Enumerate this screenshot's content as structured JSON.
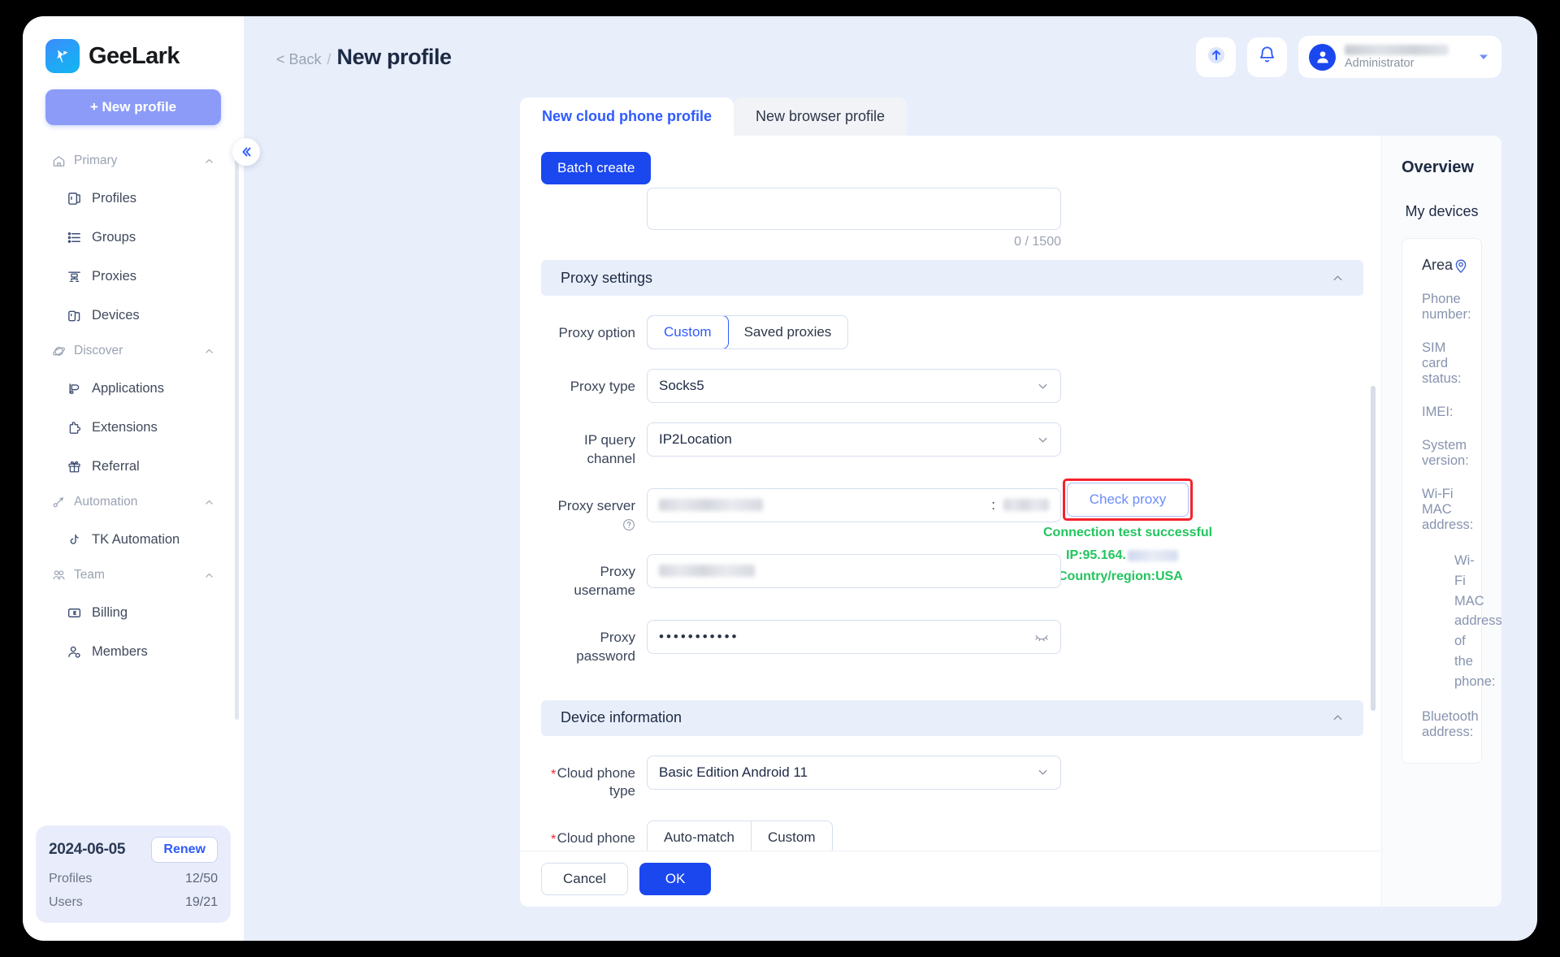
{
  "sidebar": {
    "brand": "GeeLark",
    "new_profile_button": "+ New profile",
    "collapse_icon": "chevron-double-left-icon",
    "groups": [
      {
        "label": "Primary",
        "icon": "home-icon",
        "items": [
          {
            "label": "Profiles",
            "icon": "profiles-icon"
          },
          {
            "label": "Groups",
            "icon": "groups-list-icon"
          },
          {
            "label": "Proxies",
            "icon": "proxies-network-icon"
          },
          {
            "label": "Devices",
            "icon": "devices-icon"
          }
        ]
      },
      {
        "label": "Discover",
        "icon": "discover-planet-icon",
        "items": [
          {
            "label": "Applications",
            "icon": "applications-icon"
          },
          {
            "label": "Extensions",
            "icon": "extensions-puzzle-icon"
          },
          {
            "label": "Referral",
            "icon": "referral-gift-icon"
          }
        ]
      },
      {
        "label": "Automation",
        "icon": "automation-icon",
        "items": [
          {
            "label": "TK Automation",
            "icon": "tiktok-note-icon"
          }
        ]
      },
      {
        "label": "Team",
        "icon": "team-people-icon",
        "items": [
          {
            "label": "Billing",
            "icon": "billing-card-icon"
          },
          {
            "label": "Members",
            "icon": "members-user-icon"
          }
        ]
      }
    ],
    "plan": {
      "date": "2024-06-05",
      "renew_label": "Renew",
      "rows": [
        {
          "label": "Profiles",
          "value": "12/50"
        },
        {
          "label": "Users",
          "value": "19/21"
        }
      ]
    }
  },
  "topbar": {
    "breadcrumb_back": "< Back",
    "breadcrumb_sep": "/",
    "page_title": "New profile",
    "upload_icon": "upload-arrow-icon",
    "bell_icon": "notification-bell-icon",
    "avatar_icon": "user-avatar-icon",
    "user_role": "Administrator",
    "caret_icon": "chevron-down-icon"
  },
  "tabs": [
    {
      "label": "New cloud phone profile",
      "active": true
    },
    {
      "label": "New browser profile",
      "active": false
    }
  ],
  "form": {
    "batch_create": "Batch create",
    "remark_counter": "0 / 1500",
    "proxy_section_title": "Proxy settings",
    "proxy_option_label": "Proxy option",
    "proxy_option_values": [
      "Custom",
      "Saved proxies"
    ],
    "proxy_option_selected": "Custom",
    "proxy_type_label": "Proxy type",
    "proxy_type_value": "Socks5",
    "ip_channel_label": "IP query channel",
    "ip_channel_value": "IP2Location",
    "proxy_server_label": "Proxy server",
    "proxy_server_colon": ":",
    "check_proxy_label": "Check proxy",
    "connection_result": "Connection test successful",
    "connection_ip_prefix": "IP:95.164.",
    "connection_country": "Country/region:USA",
    "proxy_username_label": "Proxy username",
    "proxy_password_label": "Proxy password",
    "proxy_password_masked": "•••••••••••",
    "device_section_title": "Device information",
    "cloud_phone_type_label": "Cloud phone type",
    "cloud_phone_type_value": "Basic Edition Android 11",
    "cloud_phone_area_label": "Cloud phone area",
    "cloud_phone_area_values": [
      "Auto-match",
      "Custom"
    ],
    "required_mark": "*"
  },
  "footer": {
    "cancel": "Cancel",
    "ok": "OK"
  },
  "overview": {
    "title": "Overview",
    "subtitle": "My devices",
    "area_label": "Area",
    "pin_icon": "location-pin-icon",
    "fields": [
      "Phone number:",
      "SIM card status:",
      "IMEI:",
      "System version:",
      "Wi-Fi MAC address:",
      "Wi-Fi MAC address of the phone:",
      "Bluetooth address:"
    ]
  },
  "colors": {
    "brand_blue": "#1b47ef",
    "accent_link": "#2f5bfc",
    "success_green": "#22c55e",
    "highlight_red": "#f5222d",
    "page_bg": "#e8eefa"
  }
}
